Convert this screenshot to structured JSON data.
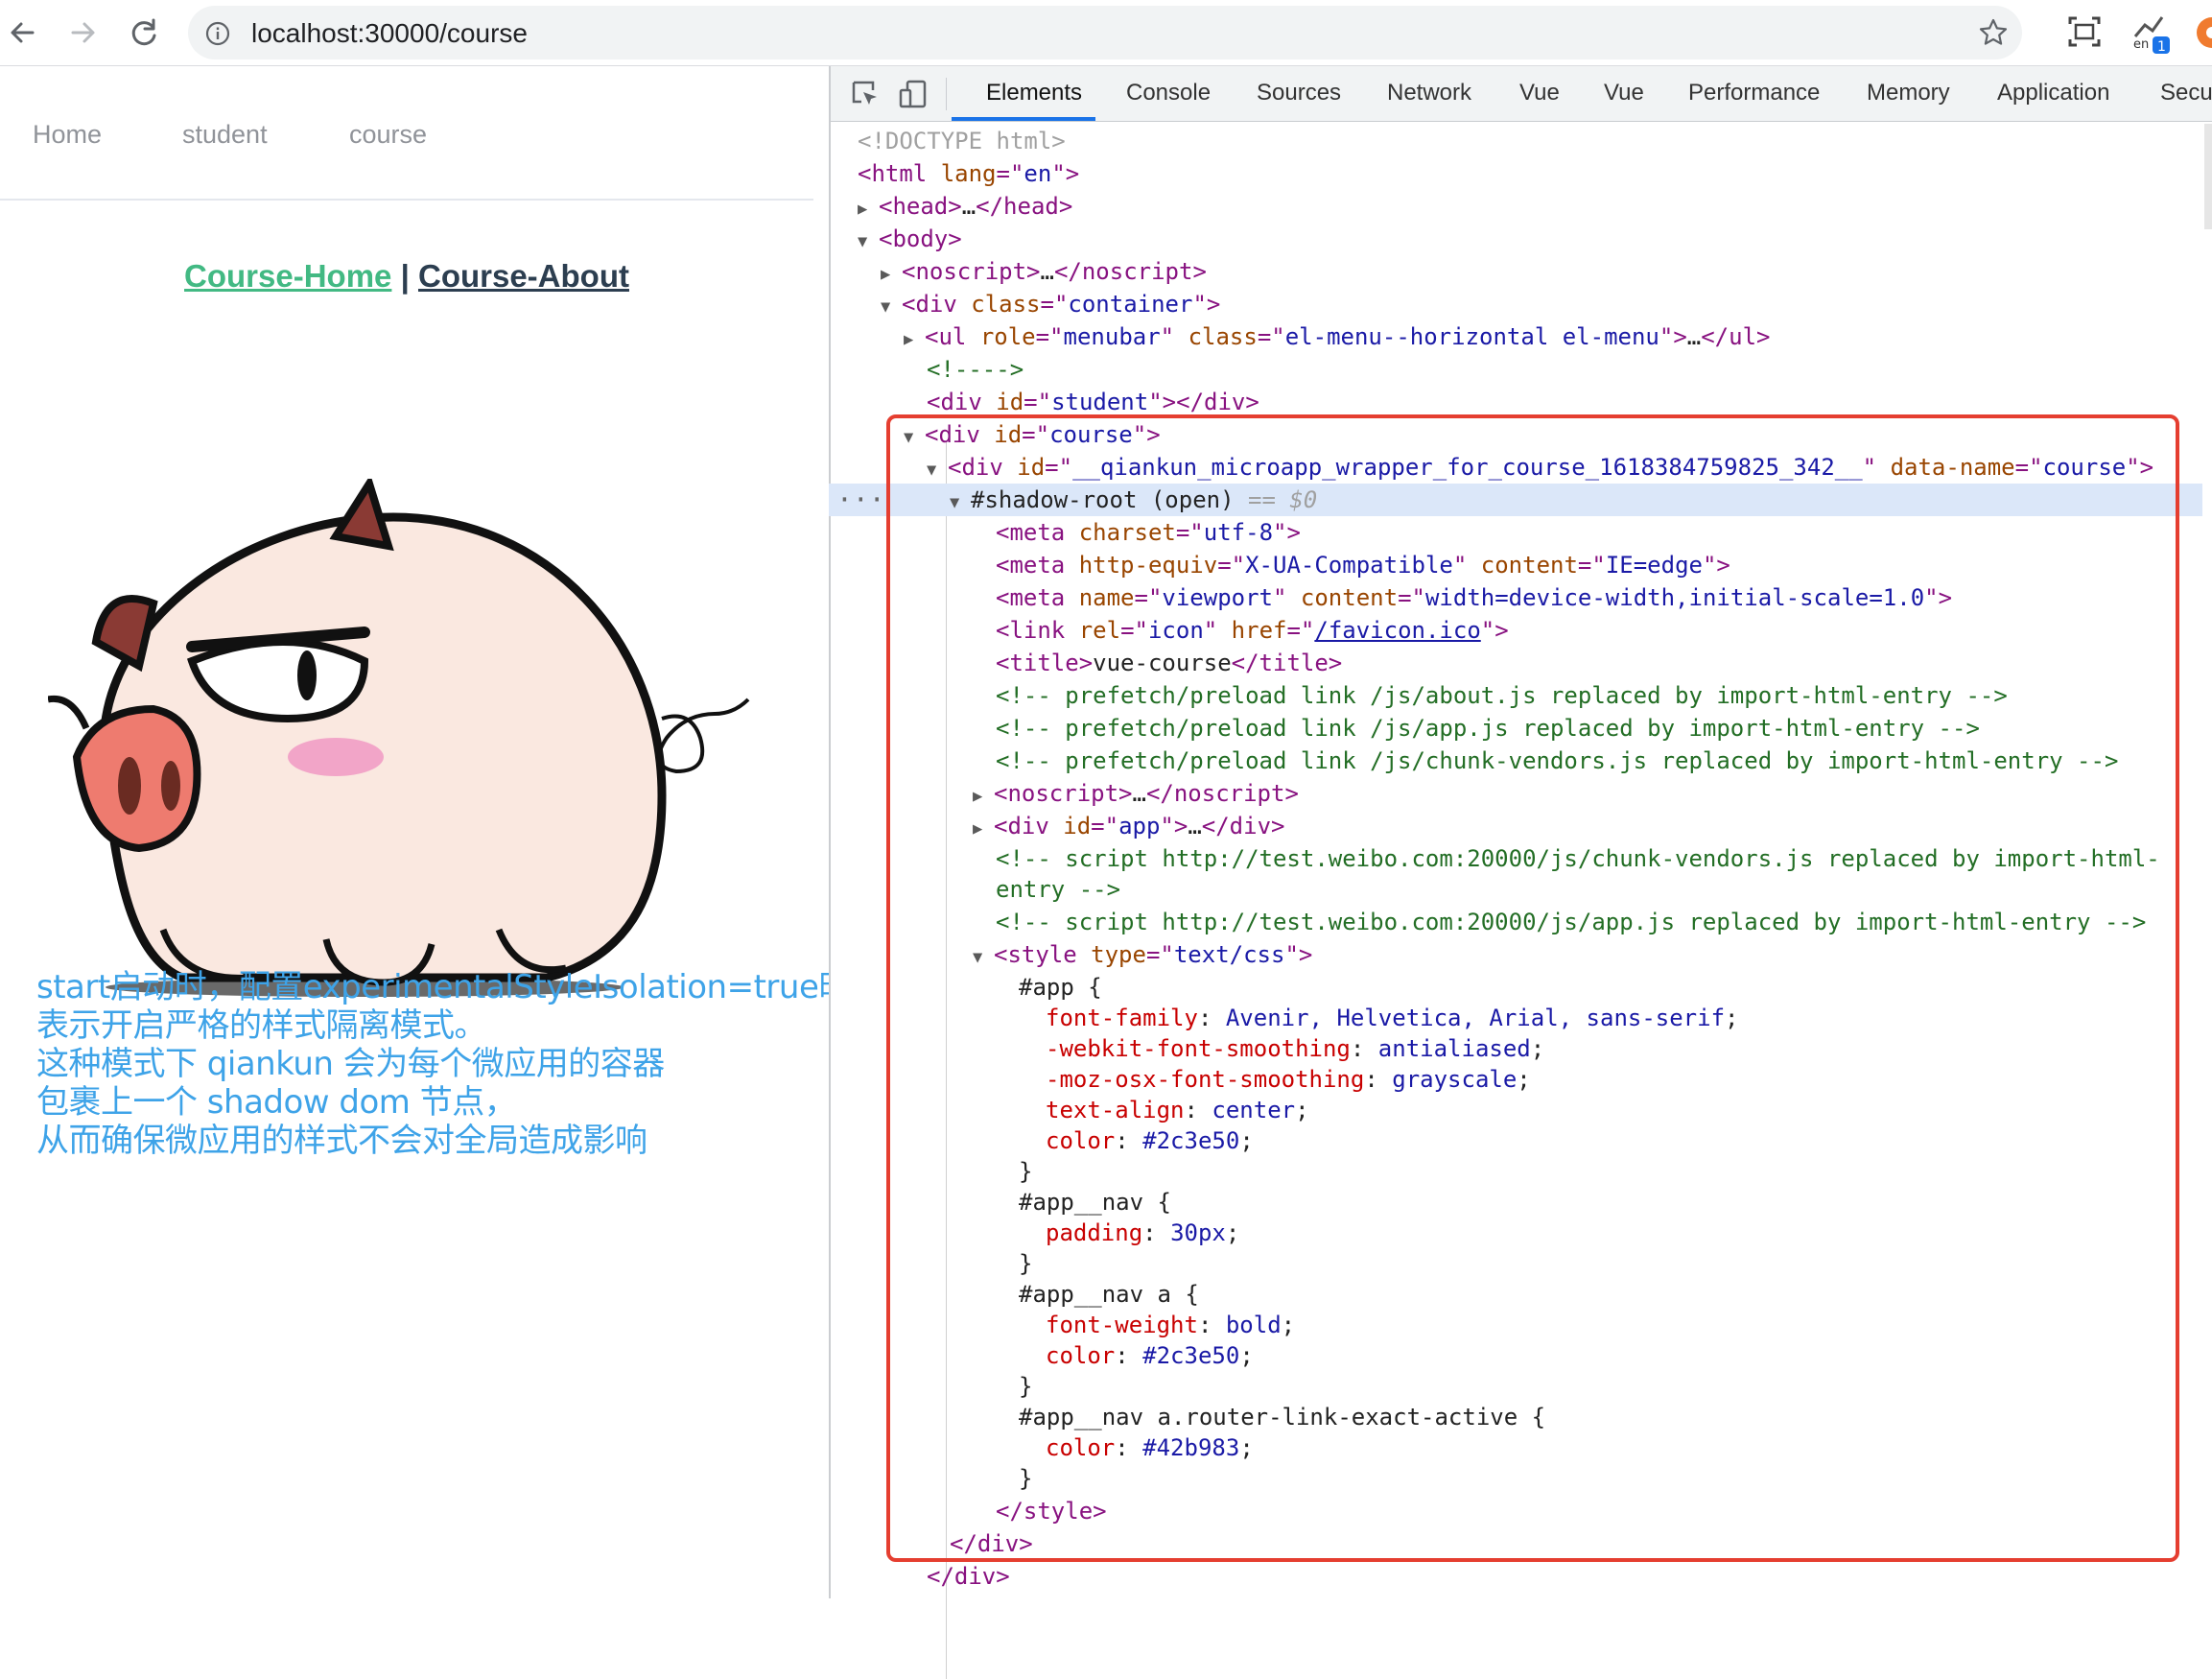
{
  "browser": {
    "url": "localhost:30000/course",
    "extension_badge": "1",
    "extension_label": "en"
  },
  "page": {
    "menu": [
      "Home",
      "student",
      "course"
    ],
    "course_nav": {
      "home": "Course-Home",
      "separator": "|",
      "about": "Course-About"
    },
    "note_lines": [
      "start启动时，配置experimentalStyleIsolation=true时，",
      "表示开启严格的样式隔离模式。",
      "这种模式下 qiankun 会为每个微应用的容器",
      "包裹上一个 shadow dom 节点，",
      "从而确保微应用的样式不会对全局造成影响"
    ],
    "note_color": "#3ea3e8",
    "active_link_color": "#42b983",
    "text_color": "#2c3e50"
  },
  "devtools": {
    "tabs": [
      "Elements",
      "Console",
      "Sources",
      "Network",
      "Vue",
      "Vue",
      "Performance",
      "Memory",
      "Application",
      "Secu"
    ],
    "active_tab": "Elements",
    "dom": {
      "doctype": "<!DOCTYPE html>",
      "html_lang": "en",
      "container_class": "container",
      "ul_role": "menubar",
      "ul_class": "el-menu--horizontal el-menu",
      "empty_comment": "<!---->",
      "student_id": "student",
      "course_id": "course",
      "wrapper_id": "__qiankun_microapp_wrapper_for_course_1618384759825_342__",
      "wrapper_data_name": "course",
      "shadow_root": "#shadow-root (open)",
      "selected_marker": "== $0",
      "meta_charset": "utf-8",
      "meta_http_equiv": "X-UA-Compatible",
      "meta_http_content": "IE=edge",
      "meta_name": "viewport",
      "meta_viewport_content": "width=device-width,initial-scale=1.0",
      "link_rel": "icon",
      "link_href": "/favicon.ico",
      "title": "vue-course",
      "comments": [
        "<!-- prefetch/preload link /js/about.js replaced by import-html-entry -->",
        "<!-- prefetch/preload link /js/app.js replaced by import-html-entry -->",
        "<!-- prefetch/preload link /js/chunk-vendors.js replaced by import-html-entry -->"
      ],
      "app_id": "app",
      "script_comment_1a": "<!--  script http://test.weibo.com:20000/js/chunk-vendors.js replaced by import-html-",
      "script_comment_1b": "entry -->",
      "script_comment_2": "<!--  script http://test.weibo.com:20000/js/app.js replaced by import-html-entry -->",
      "style_type": "text/css",
      "css": {
        "rule1_selector": "#app {",
        "rule1": [
          {
            "p": "font-family",
            "v": "Avenir, Helvetica, Arial, sans-serif"
          },
          {
            "p": "-webkit-font-smoothing",
            "v": "antialiased"
          },
          {
            "p": "-moz-osx-font-smoothing",
            "v": "grayscale"
          },
          {
            "p": "text-align",
            "v": "center"
          },
          {
            "p": "color",
            "v": "#2c3e50"
          }
        ],
        "rule2_selector": "#app__nav {",
        "rule2": [
          {
            "p": "padding",
            "v": "30px"
          }
        ],
        "rule3_selector": "#app__nav a {",
        "rule3": [
          {
            "p": "font-weight",
            "v": "bold"
          },
          {
            "p": "color",
            "v": "#2c3e50"
          }
        ],
        "rule4_selector": "#app__nav a.router-link-exact-active {",
        "rule4": [
          {
            "p": "color",
            "v": "#42b983"
          }
        ],
        "close_brace": "}"
      }
    },
    "highlight_color": "#e53e30"
  }
}
